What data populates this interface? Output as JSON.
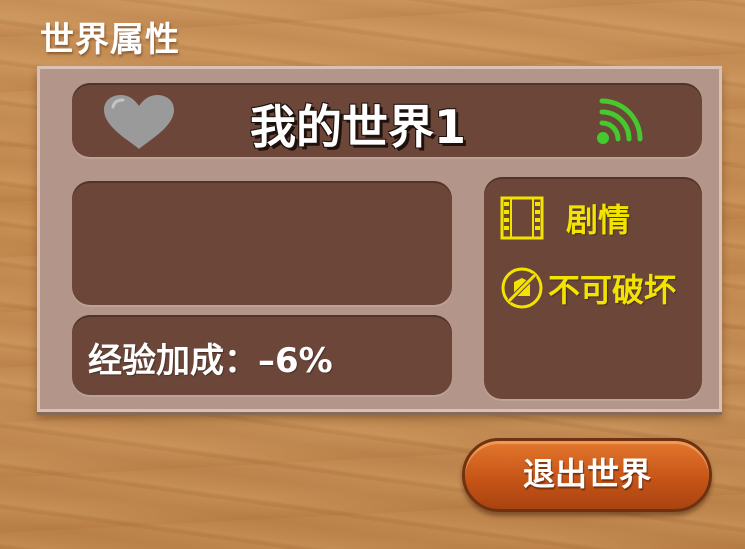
{
  "page": {
    "title": "世界属性"
  },
  "world": {
    "name": "我的世界1",
    "description": "",
    "exp_bonus": "经验加成：–6%"
  },
  "tags": [
    {
      "icon": "film-icon",
      "label": "剧情"
    },
    {
      "icon": "no-destroy-icon",
      "label": "不可破坏"
    }
  ],
  "buttons": {
    "exit_label": "退出世界"
  },
  "icons": {
    "favorite": "heart-icon",
    "signal": "wifi-signal-icon"
  },
  "colors": {
    "signal": "#46c92e",
    "tag_text": "#f3e400",
    "favorite_inactive": "#9a9a9a",
    "exit_button": "#c75518"
  }
}
